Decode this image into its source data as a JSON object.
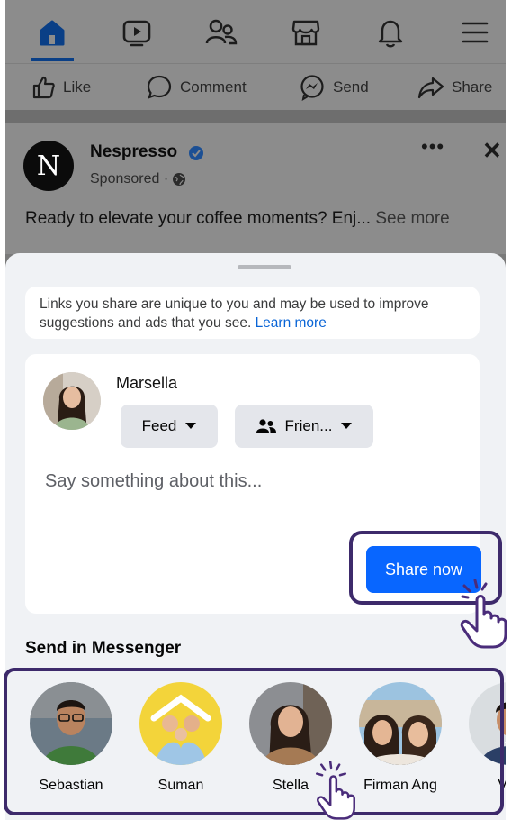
{
  "nav": {
    "icons": [
      "home-icon",
      "video-icon",
      "friends-icon",
      "marketplace-icon",
      "notifications-icon",
      "menu-icon"
    ]
  },
  "actions": {
    "like": "Like",
    "comment": "Comment",
    "send": "Send",
    "share": "Share"
  },
  "post": {
    "brand": "Nespresso",
    "logo_letter": "N",
    "sponsored": "Sponsored ·",
    "text": "Ready to elevate your coffee moments? Enj...",
    "see_more": "See more",
    "more": "•••",
    "close": "✕"
  },
  "sheet": {
    "notice_text": "Links you share are unique to you and may be used to improve suggestions and ads that you see.",
    "learn_more": "Learn more",
    "user_name": "Marsella",
    "feed_label": "Feed",
    "audience_label": "Frien...",
    "placeholder": "Say something about this...",
    "share_now": "Share now",
    "send_title": "Send in Messenger"
  },
  "contacts": [
    {
      "name": "Sebastian"
    },
    {
      "name": "Suman"
    },
    {
      "name": "Stella"
    },
    {
      "name": "Firman Ang"
    },
    {
      "name": "Van"
    }
  ],
  "colors": {
    "accent": "#0866ff",
    "highlight": "#3d2a6b",
    "sheet_bg": "#f0f2f5"
  }
}
